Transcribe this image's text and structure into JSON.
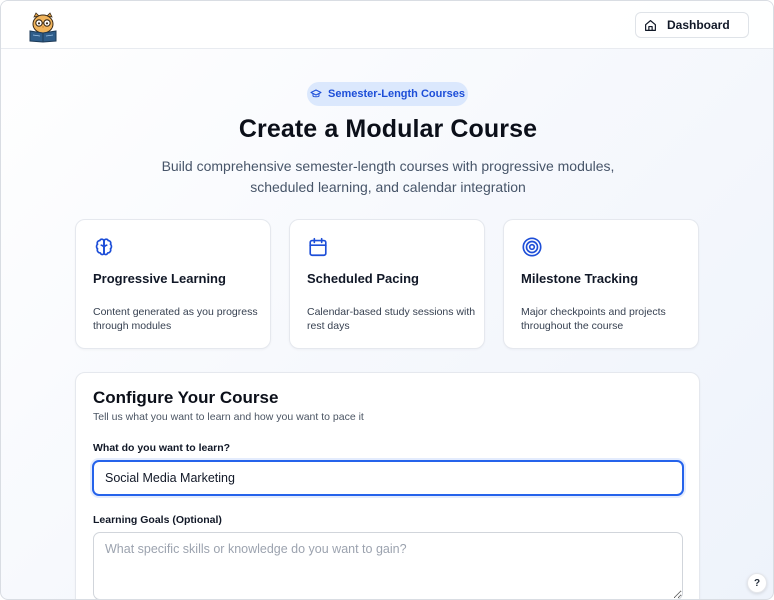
{
  "header": {
    "logo_icon": "owl-reading-book-icon",
    "dashboard_label": "Dashboard",
    "dashboard_icon": "home-icon"
  },
  "hero": {
    "badge_label": "Semester-Length Courses",
    "badge_icon": "graduation-cap-icon",
    "title": "Create a Modular Course",
    "subtitle": "Build comprehensive semester-length courses with progressive modules, scheduled learning, and calendar integration"
  },
  "features": [
    {
      "icon": "brain-icon",
      "title": "Progressive Learning",
      "description": "Content generated as you progress through modules"
    },
    {
      "icon": "calendar-icon",
      "title": "Scheduled Pacing",
      "description": "Calendar-based study sessions with rest days"
    },
    {
      "icon": "target-icon",
      "title": "Milestone Tracking",
      "description": "Major checkpoints and projects throughout the course"
    }
  ],
  "config": {
    "title": "Configure Your Course",
    "subtitle": "Tell us what you want to learn and how you want to pace it",
    "topic_label": "What do you want to learn?",
    "topic_value": "Social Media Marketing",
    "goals_label": "Learning Goals (Optional)",
    "goals_placeholder": "What specific skills or knowledge do you want to gain?"
  },
  "help_label": "?",
  "colors": {
    "accent": "#2563eb",
    "badge_bg": "#dbe8fd",
    "badge_text": "#1d4ed8"
  }
}
